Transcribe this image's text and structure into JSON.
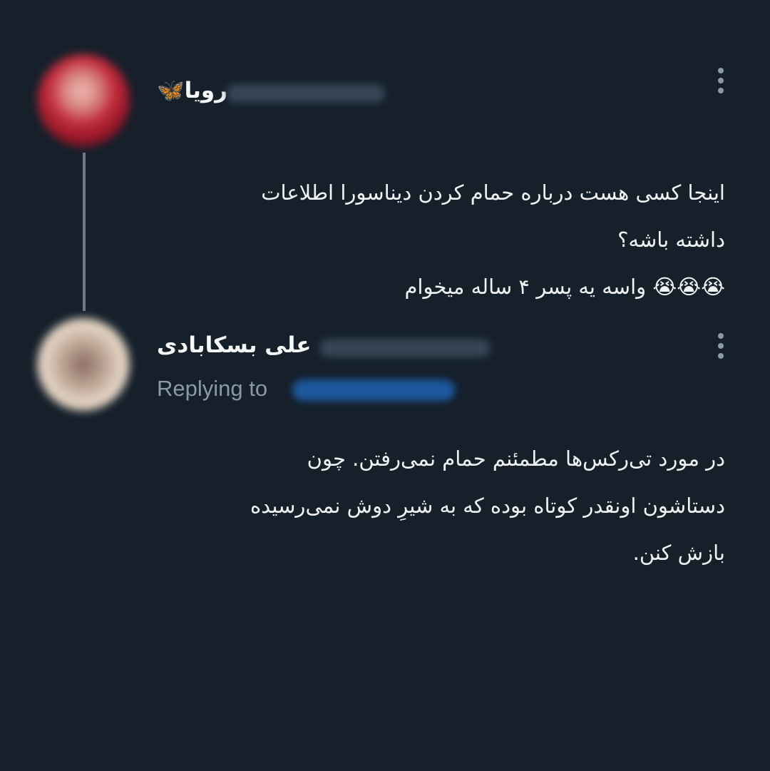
{
  "tweet1": {
    "author_name": "رویا🦋",
    "avatar_icon": "user-avatar",
    "lines": [
      "اینجا کسی هست درباره حمام کردن دیناسورا اطلاعات",
      "داشته باشه؟",
      "😭😭😭 واسه یه پسر ۴ ساله میخوام"
    ]
  },
  "tweet2": {
    "author_name": "علی بسکابادی",
    "avatar_icon": "user-avatar",
    "replying_to_label": "Replying to",
    "lines": [
      "در مورد تی‌رکس‌ها مطمئنم حمام نمی‌رفتن. چون",
      "دستاشون اونقدر کوتاه بوده که به شیرِ دوش نمی‌رسیده",
      "بازش کنن."
    ]
  },
  "colors": {
    "background": "#15202b",
    "text": "#e7e9ea",
    "muted": "#8b98a5",
    "link": "#1d9bf0"
  }
}
